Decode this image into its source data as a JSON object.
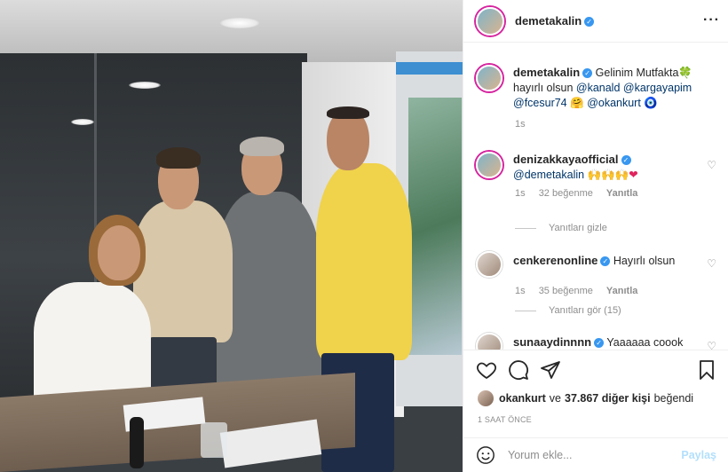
{
  "post": {
    "author": "demetakalin",
    "menu_icon": "more-horizontal-icon",
    "caption": {
      "username": "demetakalin",
      "text_start": "Gelinim Mutfakta",
      "clover_emoji": "🍀",
      "text_mid": "hayırlı olsun",
      "mentions": [
        "@kanald",
        "@kargayapim",
        "@fcesur74"
      ],
      "hug_emoji": "🤗",
      "mention_last": "@okankurt",
      "eye_emoji": "🧿",
      "time": "1s"
    }
  },
  "comments": [
    {
      "username": "denizakkaya­official",
      "mention": "@demetakalin",
      "emojis": "🙌🙌🙌",
      "heart": "❤",
      "time": "1s",
      "likes": "32 beğenme",
      "reply": "Yanıtla",
      "replies_toggle": "Yanıtları gizle"
    },
    {
      "username": "cenkerenonline",
      "text": "Hayırlı olsun",
      "time": "1s",
      "likes": "35 beğenme",
      "reply": "Yanıtla",
      "replies_toggle": "Yanıtları gör (15)"
    },
    {
      "username": "sunaaydinnnn",
      "text": "Yaaaaaa coook"
    }
  ],
  "likes": {
    "user": "okankurt",
    "connector": "ve",
    "count": "37.867 diğer kişi",
    "suffix": "beğendi"
  },
  "time_ago": "1 SAAT ÖNCE",
  "add_comment": {
    "placeholder": "Yorum ekle...",
    "post_label": "Paylaş"
  },
  "colors": {
    "link": "#003569",
    "verified": "#3897f0",
    "post_disabled": "#b2dffc",
    "muted": "#8e8e8e"
  }
}
